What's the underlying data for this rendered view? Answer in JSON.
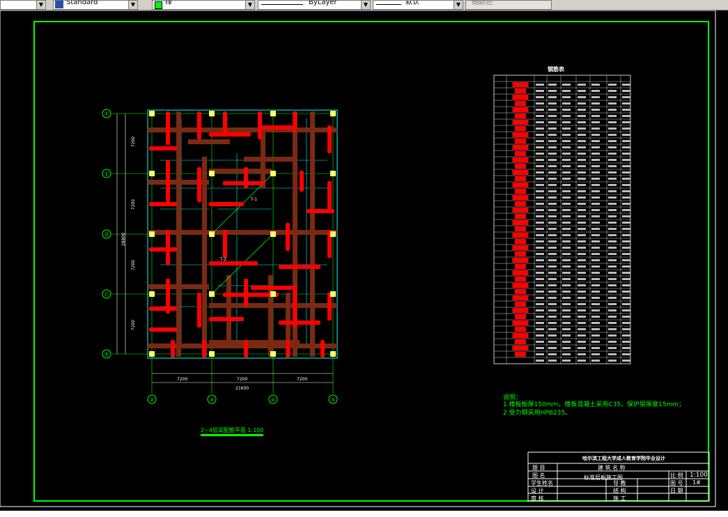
{
  "toolbar": {
    "text_style": "Standard",
    "color": "绿",
    "linetype": "ByLayer",
    "lineweight": "默认",
    "plot_style": "随颜色",
    "accent_green": "#00ff00"
  },
  "drawing": {
    "table_title": "钢筋表",
    "plan_title": "2~4层梁配筋平面 1:100",
    "dims": {
      "bay1": "7200",
      "bay2": "7200",
      "bay3": "7200",
      "total": "21600",
      "vspan1": "7200",
      "vspan2": "7200",
      "vspan3": "7200",
      "vspan4": "7200",
      "vtotal": "28800"
    },
    "grid_bottom": [
      "②",
      "③",
      "④",
      "⑤"
    ],
    "grid_left": [
      "Ⓕ",
      "Ⓔ",
      "Ⓓ",
      "Ⓒ",
      "Ⓑ"
    ],
    "beam_labels": [
      "T-1",
      "T-2"
    ],
    "notes": [
      "说明：",
      "1.楼板板厚150mm，楼板混凝土采用C35，保护层厚度15mm；",
      "2.受力钢采用HPB235。"
    ],
    "title_block": {
      "school": "哈尔滨工程大学成人教育学院毕业设计",
      "row2_left": "题  目",
      "row2_right": "建  筑  名  称",
      "row3_left": "图  名",
      "row3_mid": "标准层板施工图",
      "scale_label": "比  例",
      "scale_value": "1:100",
      "sheet_label": "图  号",
      "sheet_value": "1#",
      "student_label": "学生姓名",
      "tutor_label": "导  教",
      "structure_label": "结  构",
      "date_label": "日  期",
      "construction_label": "施  工",
      "design_label": "设  计",
      "review_label": "审  核"
    }
  }
}
